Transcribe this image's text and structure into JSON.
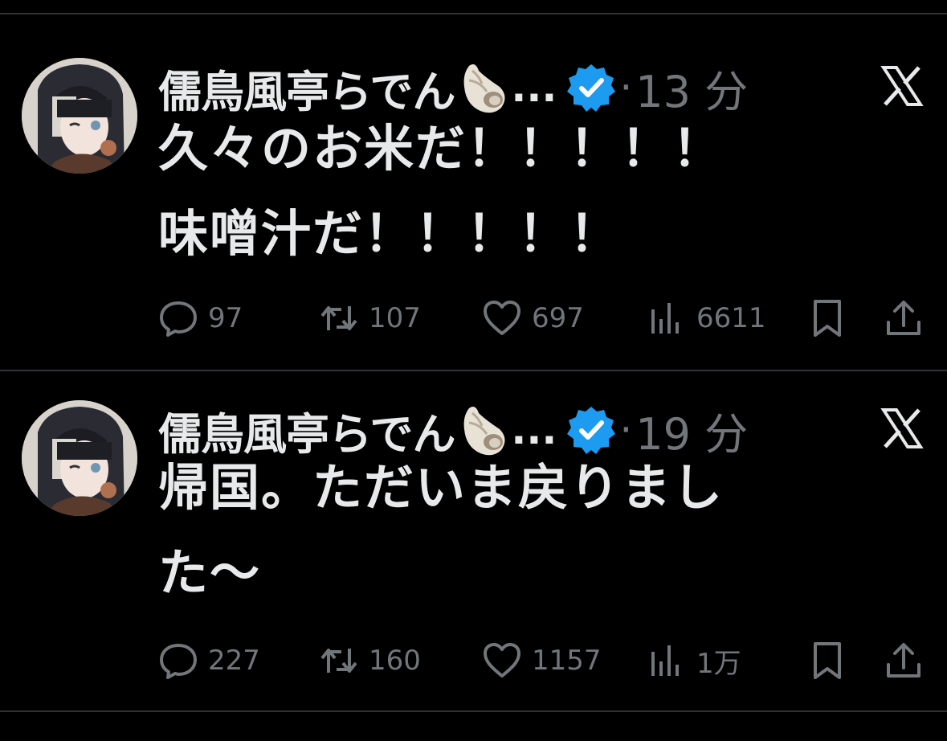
{
  "tweets": [
    {
      "author_name": "儒鳥風亭らでん",
      "ellipsis": "...",
      "time_separator": "·",
      "time": "13 分",
      "text": "久々のお米だ！！！！！\n味噌汁だ！！！！！",
      "replies": "97",
      "reposts": "107",
      "likes": "697",
      "views": "6611"
    },
    {
      "author_name": "儒鳥風亭らでん",
      "ellipsis": "...",
      "time_separator": "·",
      "time": "19 分",
      "text": "帰国。ただいま戻りまし\nた〜",
      "replies": "227",
      "reposts": "160",
      "likes": "1157",
      "views": "1万"
    }
  ],
  "icons": {
    "author_emoji": "spiral-shell-icon",
    "verified": "verified-badge-icon",
    "source": "x-logo-icon",
    "reply": "reply-icon",
    "repost": "repost-icon",
    "like": "heart-icon",
    "views": "views-chart-icon",
    "bookmark": "bookmark-icon",
    "share": "share-icon"
  },
  "colors": {
    "background": "#000000",
    "text_primary": "#e7e9ea",
    "text_secondary": "#71767b",
    "verified_blue": "#1d9bf0",
    "divider": "#2f3336"
  }
}
